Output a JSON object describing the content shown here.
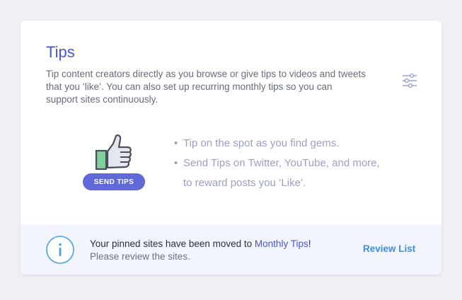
{
  "card": {
    "title": "Tips",
    "description": "Tip content creators directly as you browse or give tips to videos and tweets that you ‘like’. You can also set up recurring monthly tips so you can support sites continuously.",
    "settings_icon": "sliders-icon"
  },
  "hero": {
    "icon": "thumbs-up-icon",
    "button_label": "SEND TIPS"
  },
  "bullets": {
    "dot": "•",
    "items": [
      "Tip on the spot as you find gems.",
      "Send Tips on Twitter, YouTube, and more, to reward posts you ‘Like’."
    ]
  },
  "notice": {
    "icon": "info-icon",
    "message_prefix": "Your pinned sites have been moved to ",
    "message_link": "Monthly Tips",
    "message_suffix": "!",
    "sub_message": "Please review the sites.",
    "action_label": "Review List"
  },
  "colors": {
    "accent": "#4c54d2",
    "button": "#6168d8",
    "link_blue": "#3a8ee6",
    "notice_bg": "#f2f5fd",
    "thumb_green": "#7ecf9a"
  }
}
